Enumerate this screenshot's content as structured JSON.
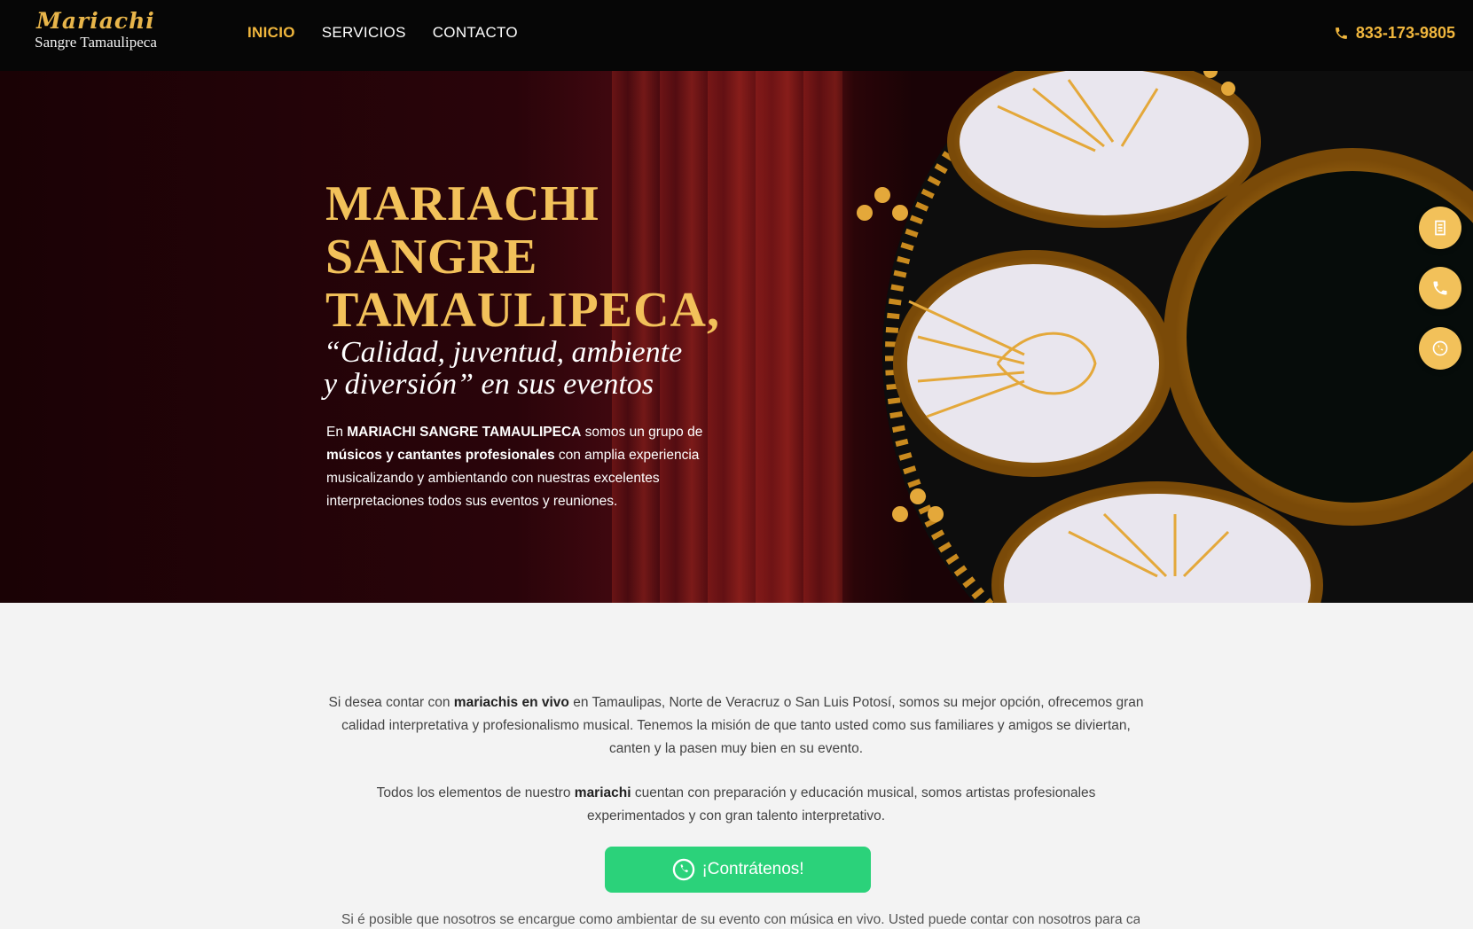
{
  "brand": {
    "script": "Mariachi",
    "sub": "Sangre Tamaulipeca"
  },
  "nav": {
    "items": [
      {
        "label": "INICIO",
        "active": true
      },
      {
        "label": "SERVICIOS",
        "active": false
      },
      {
        "label": "CONTACTO",
        "active": false
      }
    ],
    "phone": "833-173-9805"
  },
  "hero": {
    "title_line1": "MARIACHI",
    "title_line2": "SANGRE",
    "title_line3": "TAMAULIPECA,",
    "quote_line1": "“Calidad, juventud, ambiente",
    "quote_line2": "y diversión” en sus eventos",
    "text": {
      "p1": "En ",
      "b1": "MARIACHI SANGRE TAMAULIPECA",
      "p2": " somos un grupo de ",
      "b2": "músicos y cantantes profesionales",
      "p3": " con amplia experiencia musicalizando y ambientando con nuestras excelentes interpretaciones todos sus eventos y reuniones."
    }
  },
  "content": {
    "para1": {
      "a": "Si desea contar con ",
      "b": "mariachis en vivo",
      "c": " en Tamaulipas,  Norte de Veracruz o San  Luis  Potosí, somos su mejor opción, ofrecemos gran calidad interpretativa y profesionalismo musical. Tenemos la misión de que tanto usted como sus familiares y amigos se diviertan, canten y la pasen muy bien en su evento."
    },
    "para2": {
      "a": "Todos los elementos de nuestro ",
      "b": "mariachi",
      "c": " cuentan con preparación y educación musical, somos artistas profesionales experimentados y con gran talento interpretativo."
    },
    "cta": "¡Contrátenos!",
    "cut_text": "Si é posible que nosotros se encargue como ambientar de su evento con música en vivo. Usted puede contar con nosotros para cada..."
  },
  "colors": {
    "gold": "#f0b63d",
    "whatsapp": "#2bd27a",
    "nav_bg": "#060606"
  }
}
